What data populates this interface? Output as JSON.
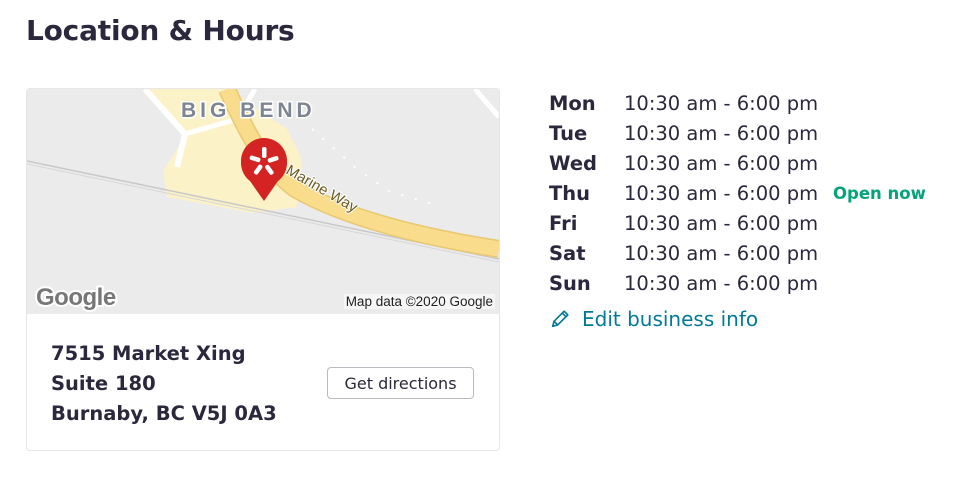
{
  "section": {
    "title": "Location & Hours"
  },
  "map": {
    "area_label": "BIG BEND",
    "road_label": "Marine Way",
    "brand_logo": "Google",
    "attribution": "Map data ©2020 Google",
    "marker_icon": "yelp-burst-icon",
    "colors": {
      "background": "#ebebeb",
      "land": "#fbf2c8",
      "road": "#f9dc8c",
      "marker": "#d32323",
      "area_label": "#7d8593"
    }
  },
  "address": {
    "line1": "7515 Market Xing",
    "line2": "Suite 180",
    "line3": "Burnaby, BC V5J 0A3"
  },
  "directions": {
    "label": "Get directions"
  },
  "hours": {
    "rows": [
      {
        "day": "Mon",
        "time": "10:30 am - 6:00 pm",
        "status": ""
      },
      {
        "day": "Tue",
        "time": "10:30 am - 6:00 pm",
        "status": ""
      },
      {
        "day": "Wed",
        "time": "10:30 am - 6:00 pm",
        "status": ""
      },
      {
        "day": "Thu",
        "time": "10:30 am - 6:00 pm",
        "status": "Open now"
      },
      {
        "day": "Fri",
        "time": "10:30 am - 6:00 pm",
        "status": ""
      },
      {
        "day": "Sat",
        "time": "10:30 am - 6:00 pm",
        "status": ""
      },
      {
        "day": "Sun",
        "time": "10:30 am - 6:00 pm",
        "status": ""
      }
    ]
  },
  "edit": {
    "label": "Edit business info",
    "icon": "pencil-icon"
  },
  "colors": {
    "heading": "#2b273c",
    "open_status": "#04a47a",
    "link": "#027a97"
  }
}
